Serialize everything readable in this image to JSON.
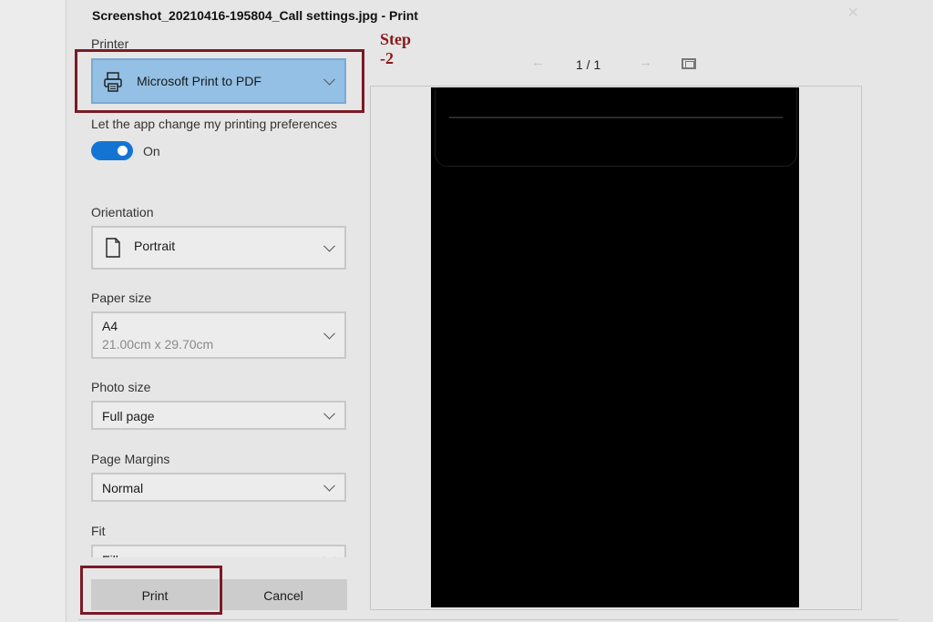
{
  "dialog": {
    "title": "Screenshot_20210416-195804_Call settings.jpg - Print",
    "close_icon": "close-icon"
  },
  "annotation": {
    "step": "Step -2",
    "color": "#8b1a1a"
  },
  "printer": {
    "label": "Printer",
    "selected": "Microsoft Print to PDF",
    "icon": "printer-icon",
    "accent": "#93c0e4"
  },
  "preferences": {
    "label": "Let the app change my printing preferences",
    "toggle_state": "On",
    "toggle_color": "#1474d4"
  },
  "orientation": {
    "label": "Orientation",
    "selected": "Portrait",
    "icon": "page-icon"
  },
  "paper_size": {
    "label": "Paper size",
    "selected": "A4",
    "dimensions": "21.00cm x 29.70cm"
  },
  "photo_size": {
    "label": "Photo size",
    "selected": "Full page"
  },
  "page_margins": {
    "label": "Page Margins",
    "selected": "Normal"
  },
  "fit": {
    "label": "Fit",
    "selected": "Fill page"
  },
  "actions": {
    "print": "Print",
    "cancel": "Cancel"
  },
  "preview": {
    "page_count": "1 / 1",
    "prev_icon": "arrow-left-icon",
    "next_icon": "arrow-right-icon",
    "fit_icon": "fit-to-window-icon"
  }
}
